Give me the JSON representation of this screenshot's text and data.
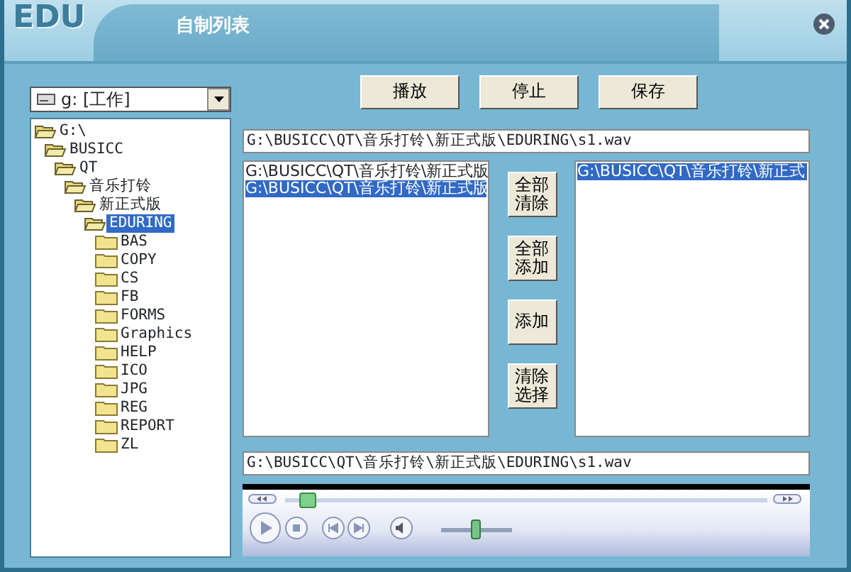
{
  "window": {
    "logo": "EDU",
    "title": "自制列表"
  },
  "drive_select": {
    "value": "g: [工作]"
  },
  "tree": [
    {
      "label": "G:\\",
      "expanded": true,
      "selected": false,
      "children": [
        {
          "label": "BUSICC",
          "expanded": true,
          "selected": false,
          "children": [
            {
              "label": "QT",
              "expanded": true,
              "selected": false,
              "children": [
                {
                  "label": "音乐打铃",
                  "expanded": true,
                  "selected": false,
                  "children": [
                    {
                      "label": "新正式版",
                      "expanded": true,
                      "selected": false,
                      "children": [
                        {
                          "label": "EDURING",
                          "expanded": true,
                          "selected": true,
                          "children": [
                            {
                              "label": "BAS",
                              "expanded": false,
                              "selected": false
                            },
                            {
                              "label": "COPY",
                              "expanded": false,
                              "selected": false
                            },
                            {
                              "label": "CS",
                              "expanded": false,
                              "selected": false
                            },
                            {
                              "label": "FB",
                              "expanded": false,
                              "selected": false
                            },
                            {
                              "label": "FORMS",
                              "expanded": false,
                              "selected": false
                            },
                            {
                              "label": "Graphics",
                              "expanded": false,
                              "selected": false
                            },
                            {
                              "label": "HELP",
                              "expanded": false,
                              "selected": false
                            },
                            {
                              "label": "ICO",
                              "expanded": false,
                              "selected": false
                            },
                            {
                              "label": "JPG",
                              "expanded": false,
                              "selected": false
                            },
                            {
                              "label": "REG",
                              "expanded": false,
                              "selected": false
                            },
                            {
                              "label": "REPORT",
                              "expanded": false,
                              "selected": false
                            },
                            {
                              "label": "ZL",
                              "expanded": false,
                              "selected": false
                            }
                          ]
                        }
                      ]
                    }
                  ]
                }
              ]
            }
          ]
        }
      ]
    }
  ],
  "toolbar": [
    "播放",
    "停止",
    "保存"
  ],
  "path_field": {
    "value": "G:\\BUSICC\\QT\\音乐打铃\\新正式版\\EDURING\\s1.wav"
  },
  "source_list": [
    {
      "label": "G:\\BUSICC\\QT\\音乐打铃\\新正式版",
      "selected": false
    },
    {
      "label": "G:\\BUSICC\\QT\\音乐打铃\\新正式版",
      "selected": true
    }
  ],
  "actions": [
    "全部清除",
    "全部添加",
    "添加",
    "清除选择"
  ],
  "target_list": [
    {
      "label": "G:\\BUSICC\\QT\\音乐打铃\\新正式",
      "selected": true
    }
  ],
  "file_field": {
    "value": "G:\\BUSICC\\QT\\音乐打铃\\新正式版\\EDURING\\s1.wav"
  },
  "player": {
    "seek": {
      "level": 0.03
    },
    "volume": {
      "level": 0.5
    }
  }
}
